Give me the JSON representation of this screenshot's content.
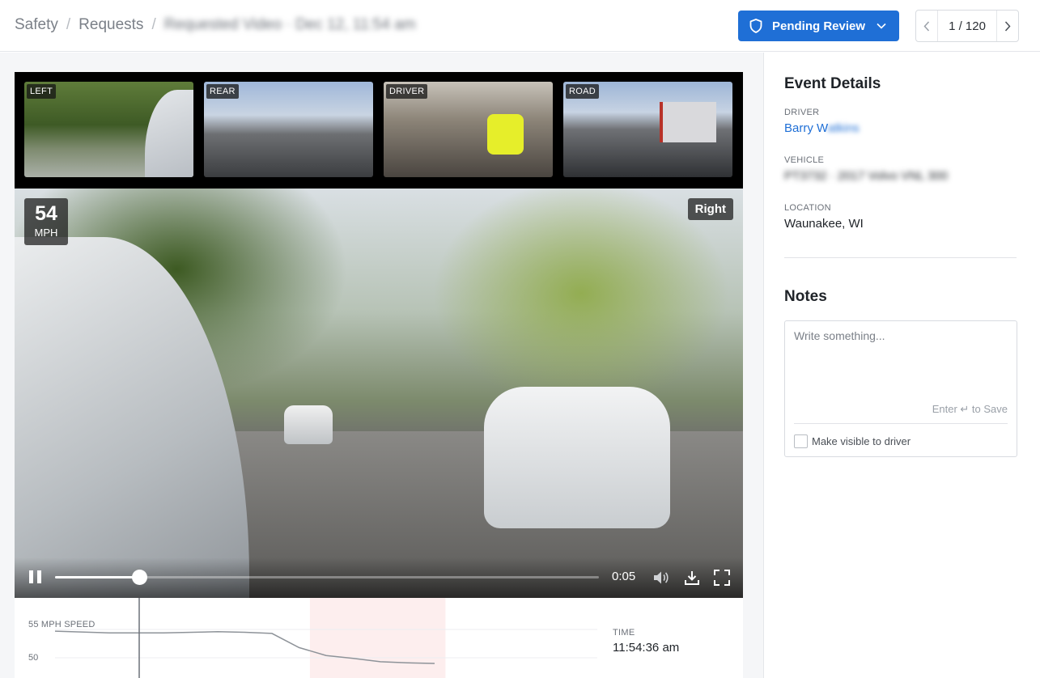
{
  "breadcrumb": {
    "items": [
      "Safety",
      "Requests"
    ],
    "separator": "/",
    "current": "Requested Video · Dec 12, 11:54 am"
  },
  "status_button": {
    "label": "Pending Review",
    "color": "#1f6fd6",
    "icon": "shield-icon"
  },
  "pager": {
    "label": "1 / 120",
    "current": 1,
    "total": 120
  },
  "cameras": [
    {
      "label": "LEFT"
    },
    {
      "label": "REAR"
    },
    {
      "label": "DRIVER"
    },
    {
      "label": "ROAD"
    }
  ],
  "player": {
    "speed_value": "54",
    "speed_unit": "MPH",
    "camera_tag": "Right",
    "time": "0:05",
    "progress": 0.155
  },
  "speed_chart": {
    "title": "55 MPH SPEED",
    "tick_label": "50",
    "time_label": "TIME",
    "time_value": "11:54:36 am"
  },
  "chart_data": {
    "type": "line",
    "title": "55 MPH SPEED",
    "ylabel": "MPH",
    "y_ticks": [
      55,
      50
    ],
    "x": [
      0,
      0.1,
      0.2,
      0.3,
      0.35,
      0.4,
      0.45,
      0.5,
      0.55,
      0.6,
      0.65,
      0.7
    ],
    "series": [
      {
        "values": [
          54.7,
          54.4,
          54.4,
          54.6,
          54.5,
          54.3,
          51.8,
          50.4,
          49.9,
          49.3,
          49.1,
          49.0
        ]
      }
    ],
    "highlight_range": [
      0.47,
      0.72
    ],
    "playhead": 0.2
  },
  "event_details": {
    "title": "Event Details",
    "driver_label": "DRIVER",
    "driver_first": "Barry W",
    "driver_rest": "atkins",
    "vehicle_label": "VEHICLE",
    "vehicle_value": "PT3732 · 2017 Volvo VNL 300",
    "location_label": "LOCATION",
    "location_value": "Waunakee, WI"
  },
  "notes": {
    "title": "Notes",
    "placeholder": "Write something...",
    "save_hint": "Enter ↵ to Save",
    "checkbox_label": "Make visible to driver"
  }
}
